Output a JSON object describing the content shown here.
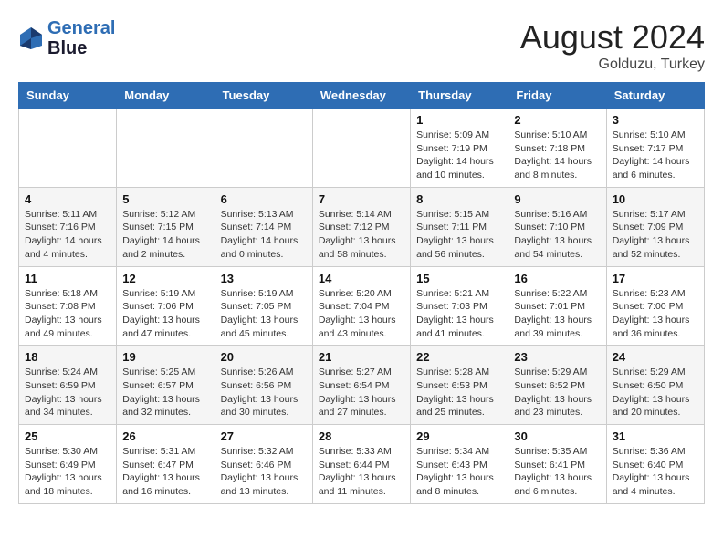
{
  "header": {
    "logo_line1": "General",
    "logo_line2": "Blue",
    "month": "August 2024",
    "location": "Golduzu, Turkey"
  },
  "weekdays": [
    "Sunday",
    "Monday",
    "Tuesday",
    "Wednesday",
    "Thursday",
    "Friday",
    "Saturday"
  ],
  "weeks": [
    [
      {
        "day": "",
        "info": ""
      },
      {
        "day": "",
        "info": ""
      },
      {
        "day": "",
        "info": ""
      },
      {
        "day": "",
        "info": ""
      },
      {
        "day": "1",
        "info": "Sunrise: 5:09 AM\nSunset: 7:19 PM\nDaylight: 14 hours\nand 10 minutes."
      },
      {
        "day": "2",
        "info": "Sunrise: 5:10 AM\nSunset: 7:18 PM\nDaylight: 14 hours\nand 8 minutes."
      },
      {
        "day": "3",
        "info": "Sunrise: 5:10 AM\nSunset: 7:17 PM\nDaylight: 14 hours\nand 6 minutes."
      }
    ],
    [
      {
        "day": "4",
        "info": "Sunrise: 5:11 AM\nSunset: 7:16 PM\nDaylight: 14 hours\nand 4 minutes."
      },
      {
        "day": "5",
        "info": "Sunrise: 5:12 AM\nSunset: 7:15 PM\nDaylight: 14 hours\nand 2 minutes."
      },
      {
        "day": "6",
        "info": "Sunrise: 5:13 AM\nSunset: 7:14 PM\nDaylight: 14 hours\nand 0 minutes."
      },
      {
        "day": "7",
        "info": "Sunrise: 5:14 AM\nSunset: 7:12 PM\nDaylight: 13 hours\nand 58 minutes."
      },
      {
        "day": "8",
        "info": "Sunrise: 5:15 AM\nSunset: 7:11 PM\nDaylight: 13 hours\nand 56 minutes."
      },
      {
        "day": "9",
        "info": "Sunrise: 5:16 AM\nSunset: 7:10 PM\nDaylight: 13 hours\nand 54 minutes."
      },
      {
        "day": "10",
        "info": "Sunrise: 5:17 AM\nSunset: 7:09 PM\nDaylight: 13 hours\nand 52 minutes."
      }
    ],
    [
      {
        "day": "11",
        "info": "Sunrise: 5:18 AM\nSunset: 7:08 PM\nDaylight: 13 hours\nand 49 minutes."
      },
      {
        "day": "12",
        "info": "Sunrise: 5:19 AM\nSunset: 7:06 PM\nDaylight: 13 hours\nand 47 minutes."
      },
      {
        "day": "13",
        "info": "Sunrise: 5:19 AM\nSunset: 7:05 PM\nDaylight: 13 hours\nand 45 minutes."
      },
      {
        "day": "14",
        "info": "Sunrise: 5:20 AM\nSunset: 7:04 PM\nDaylight: 13 hours\nand 43 minutes."
      },
      {
        "day": "15",
        "info": "Sunrise: 5:21 AM\nSunset: 7:03 PM\nDaylight: 13 hours\nand 41 minutes."
      },
      {
        "day": "16",
        "info": "Sunrise: 5:22 AM\nSunset: 7:01 PM\nDaylight: 13 hours\nand 39 minutes."
      },
      {
        "day": "17",
        "info": "Sunrise: 5:23 AM\nSunset: 7:00 PM\nDaylight: 13 hours\nand 36 minutes."
      }
    ],
    [
      {
        "day": "18",
        "info": "Sunrise: 5:24 AM\nSunset: 6:59 PM\nDaylight: 13 hours\nand 34 minutes."
      },
      {
        "day": "19",
        "info": "Sunrise: 5:25 AM\nSunset: 6:57 PM\nDaylight: 13 hours\nand 32 minutes."
      },
      {
        "day": "20",
        "info": "Sunrise: 5:26 AM\nSunset: 6:56 PM\nDaylight: 13 hours\nand 30 minutes."
      },
      {
        "day": "21",
        "info": "Sunrise: 5:27 AM\nSunset: 6:54 PM\nDaylight: 13 hours\nand 27 minutes."
      },
      {
        "day": "22",
        "info": "Sunrise: 5:28 AM\nSunset: 6:53 PM\nDaylight: 13 hours\nand 25 minutes."
      },
      {
        "day": "23",
        "info": "Sunrise: 5:29 AM\nSunset: 6:52 PM\nDaylight: 13 hours\nand 23 minutes."
      },
      {
        "day": "24",
        "info": "Sunrise: 5:29 AM\nSunset: 6:50 PM\nDaylight: 13 hours\nand 20 minutes."
      }
    ],
    [
      {
        "day": "25",
        "info": "Sunrise: 5:30 AM\nSunset: 6:49 PM\nDaylight: 13 hours\nand 18 minutes."
      },
      {
        "day": "26",
        "info": "Sunrise: 5:31 AM\nSunset: 6:47 PM\nDaylight: 13 hours\nand 16 minutes."
      },
      {
        "day": "27",
        "info": "Sunrise: 5:32 AM\nSunset: 6:46 PM\nDaylight: 13 hours\nand 13 minutes."
      },
      {
        "day": "28",
        "info": "Sunrise: 5:33 AM\nSunset: 6:44 PM\nDaylight: 13 hours\nand 11 minutes."
      },
      {
        "day": "29",
        "info": "Sunrise: 5:34 AM\nSunset: 6:43 PM\nDaylight: 13 hours\nand 8 minutes."
      },
      {
        "day": "30",
        "info": "Sunrise: 5:35 AM\nSunset: 6:41 PM\nDaylight: 13 hours\nand 6 minutes."
      },
      {
        "day": "31",
        "info": "Sunrise: 5:36 AM\nSunset: 6:40 PM\nDaylight: 13 hours\nand 4 minutes."
      }
    ]
  ]
}
